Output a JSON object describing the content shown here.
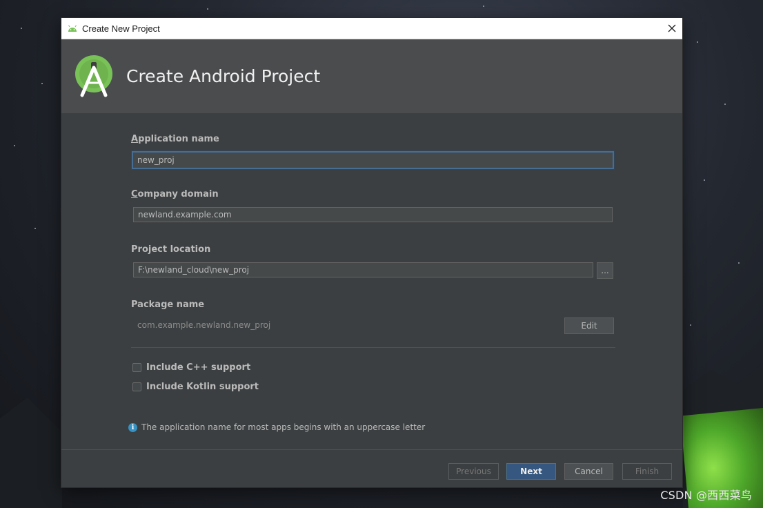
{
  "window": {
    "title": "Create New Project",
    "heading": "Create Android Project"
  },
  "form": {
    "app_name_label_accel": "A",
    "app_name_label_rest": "pplication name",
    "app_name_value": "new_proj",
    "company_label_accel": "C",
    "company_label_rest": "ompany domain",
    "company_value": "newland.example.com",
    "location_label": "Project location",
    "location_value": "F:\\newland_cloud\\new_proj",
    "browse_label": "...",
    "package_label": "Package name",
    "package_value": "com.example.newland.new_proj",
    "edit_label": "Edit"
  },
  "options": [
    {
      "label": "Include C++ support",
      "checked": false
    },
    {
      "label": "Include Kotlin support",
      "checked": false
    }
  ],
  "info": {
    "icon": "i",
    "text": "The application name for most apps begins with an uppercase letter"
  },
  "buttons": {
    "previous": "Previous",
    "next": "Next",
    "cancel": "Cancel",
    "finish": "Finish"
  },
  "watermark": "CSDN @西西菜鸟",
  "colors": {
    "android_green": "#a4c639",
    "accent_blue": "#365880",
    "dialog_bg": "#3c3f41"
  }
}
